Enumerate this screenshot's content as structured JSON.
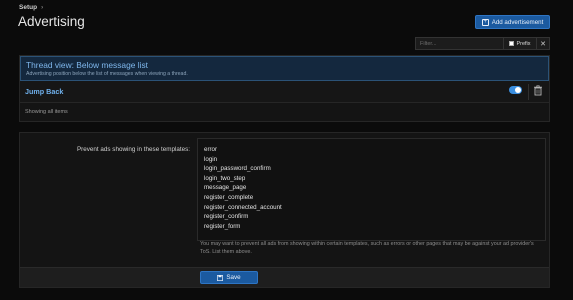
{
  "breadcrumb": {
    "items": [
      "Setup"
    ],
    "separator": "›"
  },
  "page": {
    "title": "Advertising",
    "add_button_label": "Add advertisement"
  },
  "filter": {
    "placeholder": "Filter...",
    "prefix_label": "Prefix",
    "clear_label": "✕"
  },
  "ad_position": {
    "title": "Thread view: Below message list",
    "description": "Advertising position below the list of messages when viewing a thread.",
    "items": [
      {
        "name": "Jump Back",
        "enabled": true
      }
    ],
    "footer": "Showing all items"
  },
  "options": {
    "label": "Prevent ads showing in these templates:",
    "templates": [
      "error",
      "login",
      "login_password_confirm",
      "login_two_step",
      "message_page",
      "register_complete",
      "register_connected_account",
      "register_confirm",
      "register_form"
    ],
    "help": "You may want to prevent all ads from showing within certain templates, such as errors or other pages that may be against your ad provider's ToS. List them above.",
    "save_label": "Save"
  },
  "colors": {
    "accent": "#1b5aa0",
    "link": "#6fb0ec",
    "background": "#0b0b0b"
  }
}
